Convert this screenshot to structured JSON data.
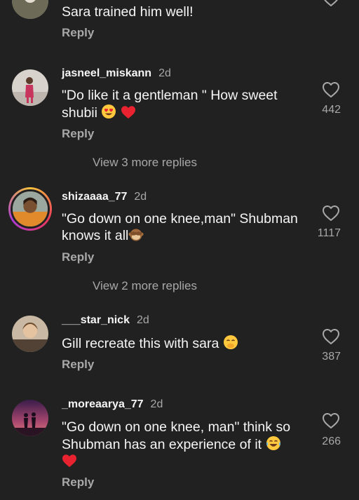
{
  "comments": [
    {
      "username": "",
      "time": "",
      "text": "Sara trained him well!",
      "reply": "Reply",
      "likes": ""
    },
    {
      "username": "jasneel_miskann",
      "time": "2d",
      "text": "\"Do like it a gentleman \" How sweet shubii",
      "reply": "Reply",
      "likes": "442",
      "more_replies": "View 3 more replies"
    },
    {
      "username": "shizaaaa_77",
      "time": "2d",
      "text": "\"Go down on one knee,man\" Shubman knows it all",
      "reply": "Reply",
      "likes": "1117",
      "more_replies": "View 2 more replies"
    },
    {
      "username": "___star_nick",
      "time": "2d",
      "text": "Gill recreate this with sara",
      "reply": "Reply",
      "likes": "387"
    },
    {
      "username": "_moreaarya_77",
      "time": "2d",
      "text": "\"Go down on one knee, man\" think so Shubman has an experience of it",
      "reply": "Reply",
      "likes": "266"
    }
  ],
  "icons": {
    "like": "heart-outline-icon",
    "emojis": [
      "heart-eyes-emoji",
      "red-heart-emoji",
      "see-no-evil-monkey-emoji",
      "smiling-face-with-hand-over-mouth-emoji",
      "tears-of-joy-emoji",
      "red-heart-emoji"
    ]
  },
  "colors": {
    "background": "#212121",
    "primary_text": "#f5f5f5",
    "secondary_text": "#a8a8a8",
    "heart_red": "#e8232f"
  }
}
